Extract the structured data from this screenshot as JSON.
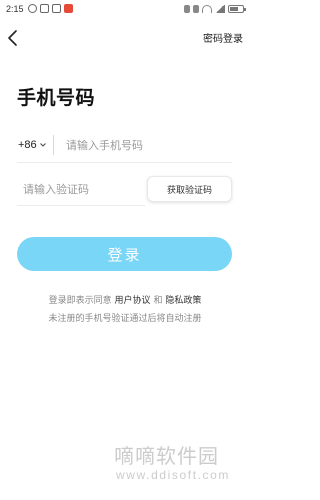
{
  "status_bar": {
    "time": "2:15",
    "battery_level_fraction": 0.7
  },
  "nav": {
    "back_icon": "chevron-left-icon",
    "password_login": "密码登录"
  },
  "title": "手机号码",
  "phone": {
    "country_code": "+86",
    "placeholder": "请输入手机号码",
    "value": ""
  },
  "code": {
    "placeholder": "请输入验证码",
    "value": "",
    "get_code_label": "获取验证码"
  },
  "login_button": "登录",
  "agreement": {
    "prefix": "登录即表示同意",
    "user_agreement": "用户协议",
    "and": "和",
    "privacy_policy": "隐私政策",
    "note": "未注册的手机号验证通过后将自动注册"
  },
  "colors": {
    "accent": "#79d6f6",
    "text": "#1a1a1a",
    "muted": "#888888"
  },
  "watermark": {
    "name": "嘀嘀软件园",
    "url": "www.ddisoft.com"
  }
}
